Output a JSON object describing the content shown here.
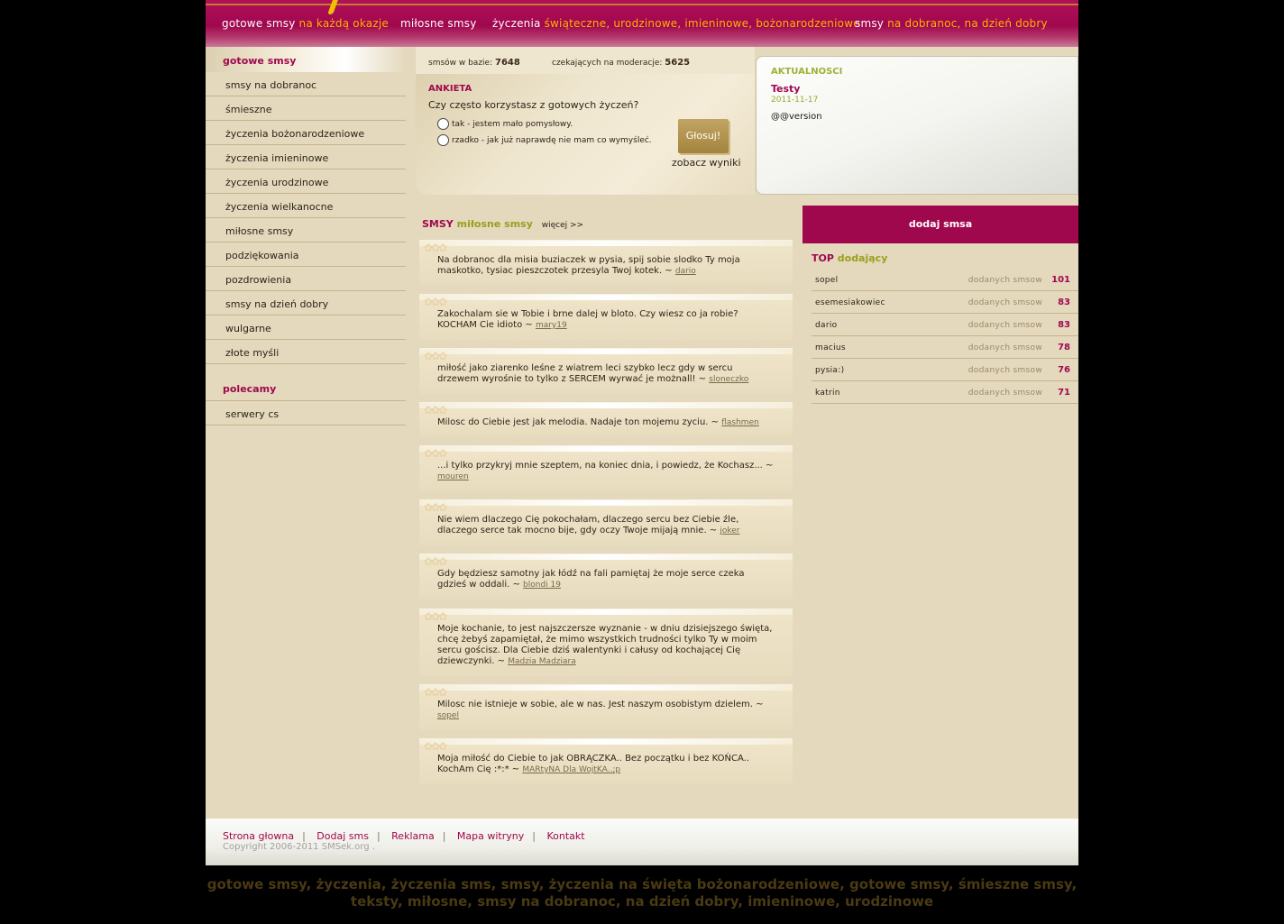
{
  "nav": [
    {
      "main": "gotowe smsy",
      "hl": "na każdą okazje"
    },
    {
      "main": "miłosne smsy",
      "hl": ""
    },
    {
      "main": "życzenia",
      "hl": "świąteczne, urodzinowe, imieninowe, bożonarodzeniowe"
    },
    {
      "main": "smsy",
      "hl": "na dobranoc, na dzień dobry"
    }
  ],
  "sidebar": {
    "heading": "gotowe smsy",
    "items": [
      "smsy na dobranoc",
      "śmieszne",
      "życzenia bożonarodzeniowe",
      "życzenia imieninowe",
      "życzenia urodzinowe",
      "życzenia wielkanocne",
      "miłosne smsy",
      "podziękowania",
      "pozdrowienia",
      "smsy na dzień dobry",
      "wulgarne",
      "złote myśli"
    ],
    "heading2": "polecamy",
    "items2": [
      "serwery cs"
    ]
  },
  "stats": {
    "db_label": "smsów w bazie:",
    "db_value": "7648",
    "mod_label": "czekających na moderacje:",
    "mod_value": "5625"
  },
  "poll": {
    "title": "ANKIETA",
    "question": "Czy często korzystasz z gotowych życzeń?",
    "options": [
      "tak - jestem mało pomysłowy.",
      "rzadko - jak już naprawdę nie mam co wymyśleć."
    ],
    "vote": "Głosuj!",
    "results": "zobacz wyniki"
  },
  "news": {
    "heading": "AKTUALNOSCI",
    "title": "Testy",
    "date": "2011-11-17",
    "text": "@@version"
  },
  "sms_section": {
    "a": "SMSY",
    "b": "miłosne smsy",
    "more": "więcej >>"
  },
  "sms": [
    {
      "text": "Na dobranoc dla misia buziaczek w pysia, spij sobie slodko Ty moja maskotko, tysiac pieszczotek przesyla Twoj kotek. ~",
      "author": "dario"
    },
    {
      "text": "Zakochalam sie w Tobie i brne dalej w bloto. Czy wiesz co ja robie? KOCHAM Cie idioto ~",
      "author": "mary19"
    },
    {
      "text": "miłość jako ziarenko leśne z wiatrem leci szybko lecz gdy w sercu drzewem wyrośnie to tylko z SERCEM wyrwać je możnall! ~",
      "author": "sloneczko"
    },
    {
      "text": "Milosc do Ciebie jest jak melodia. Nadaje ton mojemu zyciu. ~",
      "author": "flashmen"
    },
    {
      "text": "...i tylko przykryj mnie szeptem, na koniec dnia, i powiedz, że Kochasz... ~",
      "author": "mouren"
    },
    {
      "text": "Nie wiem dlaczego Cię pokochałam, dlaczego sercu bez Ciebie źle, dlaczego serce tak mocno bije, gdy oczy Twoje mijają mnie. ~",
      "author": "joker"
    },
    {
      "text": "Gdy będziesz samotny jak łódź na fali pamiętaj że moje serce czeka gdzieś w oddali. ~",
      "author": "blondi 19"
    },
    {
      "text": "Moje kochanie, to jest najszczersze wyznanie - w dniu dzisiejszego święta, chcę żebyś zapamiętał, że mimo wszystkich trudności tylko Ty w moim sercu gościsz. Dla Ciebie dziś walentynki i całusy od kochającej Cię dziewczynki. ~",
      "author": "Madzia Madziara"
    },
    {
      "text": "Milosc nie istnieje w sobie, ale w nas. Jest naszym osobistym dzielem. ~",
      "author": "sopel"
    },
    {
      "text": "Moja miłość do Ciebie to jak OBRĄCZKA.. Bez początku i bez KOŃCA.. KochAm Cię :*:* ~",
      "author": "MARtyNA Dla WojtKA..;p"
    }
  ],
  "add_button": "dodaj smsa",
  "top": {
    "a": "TOP",
    "b": "dodający",
    "rows": [
      {
        "name": "sopel",
        "label": "dodanych smsow",
        "value": "101"
      },
      {
        "name": "esemesiakowiec",
        "label": "dodanych smsow",
        "value": "83"
      },
      {
        "name": "dario",
        "label": "dodanych smsow",
        "value": "83"
      },
      {
        "name": "macius",
        "label": "dodanych smsow",
        "value": "78"
      },
      {
        "name": "pysia:)",
        "label": "dodanych smsow",
        "value": "76"
      },
      {
        "name": "katrin",
        "label": "dodanych smsow",
        "value": "71"
      }
    ]
  },
  "footer": {
    "links": [
      "Strona głowna",
      "Dodaj sms",
      "Reklama",
      "Mapa witryny",
      "Kontakt"
    ],
    "copyright": "Copyright 2006-2011 SMSek.org ."
  },
  "seo": "gotowe smsy, życzenia, życzenia sms, smsy, życzenia na święta bożonarodzeniowe, gotowe smsy, śmieszne smsy, teksty, miłosne, smsy na dobranoc, na dzień dobry, imieninowe, urodzinowe",
  "colors": {
    "brand": "#a0084e",
    "accent": "#ffb400",
    "green": "#98a020",
    "bg": "#e4d8bd"
  }
}
